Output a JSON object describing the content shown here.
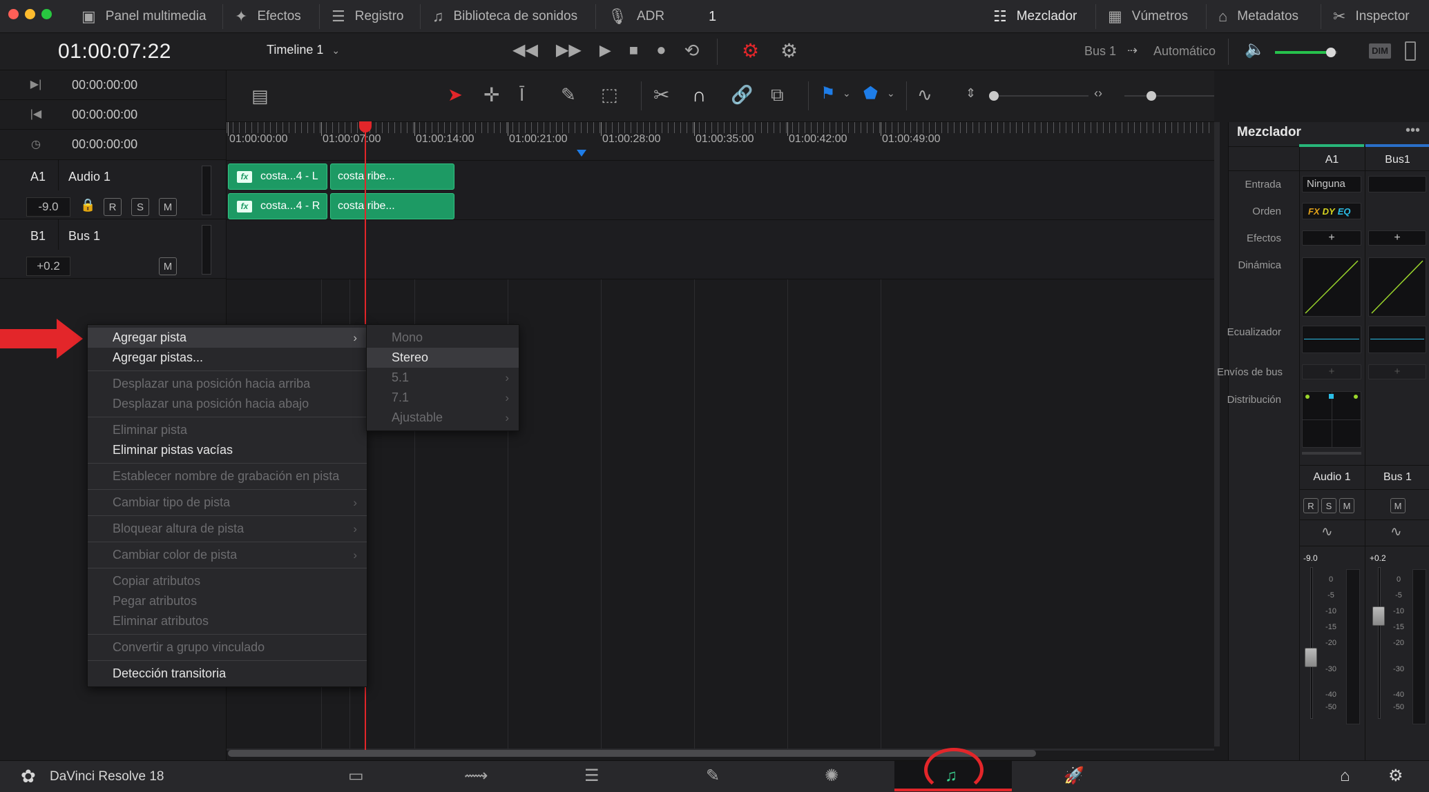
{
  "topbar": {
    "left": [
      {
        "icon": "media-pool-icon",
        "label": "Panel multimedia"
      },
      {
        "icon": "effects-icon",
        "label": "Efectos"
      },
      {
        "icon": "index-icon",
        "label": "Registro"
      },
      {
        "icon": "sound-library-icon",
        "label": "Biblioteca de sonidos"
      },
      {
        "icon": "adr-icon",
        "label": "ADR"
      }
    ],
    "center_number": "1",
    "right": [
      {
        "icon": "mixer-icon",
        "label": "Mezclador"
      },
      {
        "icon": "meters-icon",
        "label": "Vúmetros"
      },
      {
        "icon": "metadata-icon",
        "label": "Metadatos"
      },
      {
        "icon": "inspector-icon",
        "label": "Inspector"
      }
    ]
  },
  "transport": {
    "timecode": "01:00:07:22",
    "timeline_name": "Timeline 1",
    "bus_label": "Bus 1",
    "auto_label": "Automático",
    "dim_label": "DIM",
    "volume_level": 0.9
  },
  "left_panel": {
    "timecodes": [
      "00:00:00:00",
      "00:00:00:00",
      "00:00:00:00"
    ],
    "tracks": [
      {
        "id": "A1",
        "name": "Audio 1",
        "volume": "-9.0",
        "buttons": [
          "R",
          "S",
          "M"
        ]
      },
      {
        "id": "B1",
        "name": "Bus 1",
        "volume": "+0.2",
        "buttons": [
          "M"
        ]
      }
    ]
  },
  "ruler": {
    "labels": [
      "01:00:00:00",
      "01:00:07:00",
      "01:00:14:00",
      "01:00:21:00",
      "01:00:28:00",
      "01:00:35:00",
      "01:00:42:00",
      "01:00:49:00"
    ]
  },
  "clips": {
    "row1": [
      "costa...4 - L",
      "costa ribe..."
    ],
    "row2": [
      "costa...4 - R",
      "costa ribe..."
    ],
    "fx": "fx"
  },
  "mixer": {
    "title": "Mezclador",
    "channels": [
      "A1",
      "Bus1"
    ],
    "row_labels": {
      "input": "Entrada",
      "order": "Orden",
      "effects": "Efectos",
      "dynamics": "Dinámica",
      "eq": "Ecualizador",
      "bus_sends": "Envíos de bus",
      "pan": "Distribución"
    },
    "input_value": "Ninguna",
    "order_tags": [
      "FX",
      "DY",
      "EQ"
    ],
    "plus": "+",
    "names": [
      "Audio 1",
      "Bus 1"
    ],
    "strip_buttons_a1": [
      "R",
      "S",
      "M"
    ],
    "strip_buttons_bus": [
      "M"
    ],
    "fader_values": [
      "-9.0",
      "+0.2"
    ],
    "scale": [
      "0",
      "-5",
      "-10",
      "-15",
      "-20",
      "-30",
      "-40",
      "-50"
    ]
  },
  "context_menu": {
    "items": [
      {
        "label": "Agregar pista",
        "enabled": true,
        "submenu": true,
        "highlight": true
      },
      {
        "label": "Agregar pistas...",
        "enabled": true
      },
      {
        "sep": true
      },
      {
        "label": "Desplazar una posición hacia arriba",
        "enabled": false
      },
      {
        "label": "Desplazar una posición hacia abajo",
        "enabled": false
      },
      {
        "sep": true
      },
      {
        "label": "Eliminar pista",
        "enabled": false
      },
      {
        "label": "Eliminar pistas vacías",
        "enabled": true
      },
      {
        "sep": true
      },
      {
        "label": "Establecer nombre de grabación en pista",
        "enabled": false
      },
      {
        "sep": true
      },
      {
        "label": "Cambiar tipo de pista",
        "enabled": false,
        "submenu": true
      },
      {
        "sep": true
      },
      {
        "label": "Bloquear altura de pista",
        "enabled": false,
        "submenu": true
      },
      {
        "sep": true
      },
      {
        "label": "Cambiar color de pista",
        "enabled": false,
        "submenu": true
      },
      {
        "sep": true
      },
      {
        "label": "Copiar atributos",
        "enabled": false
      },
      {
        "label": "Pegar atributos",
        "enabled": false
      },
      {
        "label": "Eliminar atributos",
        "enabled": false
      },
      {
        "sep": true
      },
      {
        "label": "Convertir a grupo vinculado",
        "enabled": false
      },
      {
        "sep": true
      },
      {
        "label": "Detección transitoria",
        "enabled": true
      }
    ]
  },
  "submenu": {
    "items": [
      {
        "label": "Mono",
        "enabled": false
      },
      {
        "label": "Stereo",
        "enabled": true,
        "highlight": true
      },
      {
        "label": "5.1",
        "enabled": false,
        "submenu": true
      },
      {
        "label": "7.1",
        "enabled": false,
        "submenu": true
      },
      {
        "label": "Ajustable",
        "enabled": false,
        "submenu": true
      }
    ]
  },
  "bottombar": {
    "app_name": "DaVinci Resolve 18",
    "pages": [
      "media-page-icon",
      "cut-page-icon",
      "edit-page-icon",
      "fusion-page-icon",
      "color-page-icon",
      "fairlight-page-icon",
      "deliver-page-icon"
    ],
    "active_page": 5
  },
  "colors": {
    "accent_red": "#e3262a",
    "clip_green": "#1d9a64",
    "fairlight_green": "#3ad08e",
    "eq_cyan": "#2bbde6",
    "dyn_green": "#9bd62c"
  }
}
